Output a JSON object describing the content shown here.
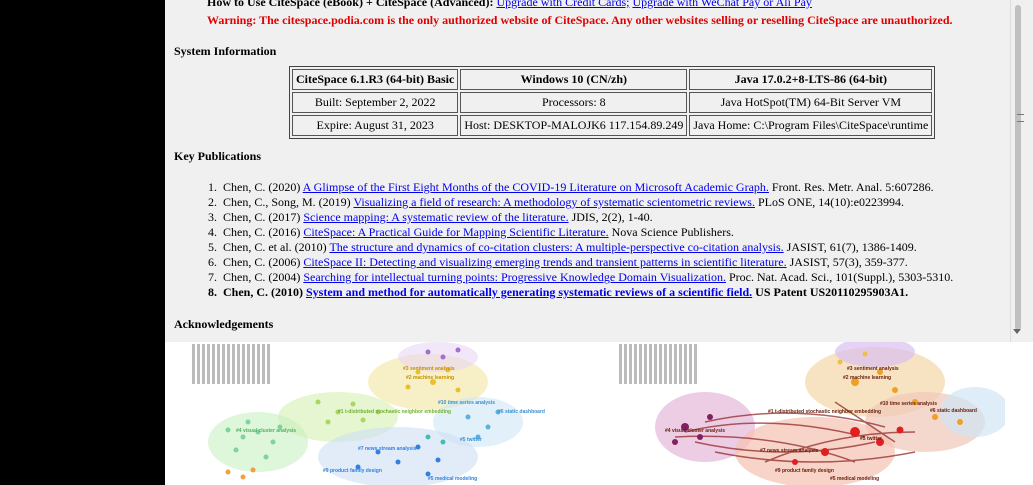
{
  "header": {
    "line1_label": "How to Use CiteSpace (eBook) + CiteSpace (Advanced):",
    "line1_link1": "Upgrade with Credit Cards;",
    "line1_link2": "Upgrade with WeChat Pay or Ali Pay",
    "warning": "Warning: The citespace.podia.com is the only authorized website of CiteSpace. Any other websites selling or reselling CiteSpace are unauthorized."
  },
  "system_info": {
    "heading": "System Information",
    "rows": [
      [
        "CiteSpace 6.1.R3 (64-bit) Basic",
        "Windows 10 (CN/zh)",
        "Java 17.0.2+8-LTS-86 (64-bit)"
      ],
      [
        "Built: September 2, 2022",
        "Processors: 8",
        "Java HotSpot(TM) 64-Bit Server VM"
      ],
      [
        "Expire: August 31, 2023",
        "Host: DESKTOP-MALOJK6 117.154.89.249",
        "Java Home: C:\\Program Files\\CiteSpace\\runtime"
      ]
    ]
  },
  "publications": {
    "heading": "Key Publications",
    "items": [
      {
        "num": "1.",
        "pre": "Chen, C. (2020)",
        "link": "A Glimpse of the First Eight Months of the COVID-19 Literature on Microsoft Academic Graph.",
        "post": "Front. Res. Metr. Anal. 5:607286."
      },
      {
        "num": "2.",
        "pre": "Chen, C., Song, M. (2019)",
        "link": "Visualizing a field of research: A methodology of systematic scientometric reviews.",
        "post": "PLoS ONE, 14(10):e0223994."
      },
      {
        "num": "3.",
        "pre": "Chen, C. (2017)",
        "link": "Science mapping: A systematic review of the literature.",
        "post": "JDIS, 2(2), 1-40."
      },
      {
        "num": "4.",
        "pre": "Chen, C. (2016)",
        "link": "CiteSpace: A Practical Guide for Mapping Scientific Literature.",
        "post": "Nova Science Publishers."
      },
      {
        "num": "5.",
        "pre": "Chen, C. et al. (2010)",
        "link": "The structure and dynamics of co-citation clusters: A multiple-perspective co-citation analysis.",
        "post": "JASIST, 61(7), 1386-1409."
      },
      {
        "num": "6.",
        "pre": "Chen, C. (2006)",
        "link": "CiteSpace II: Detecting and visualizing emerging trends and transient patterns in scientific literature.",
        "post": "JASIST, 57(3), 359-377."
      },
      {
        "num": "7.",
        "pre": "Chen, C. (2004)",
        "link": "Searching for intellectual turning points: Progressive Knowledge Domain Visualization.",
        "post": "Proc. Nat. Acad. Sci., 101(Suppl.), 5303-5310."
      },
      {
        "num": "8.",
        "pre": "Chen, C. (2010)",
        "link": "System and method for automatically generating systematic reviews of a scientific field.",
        "post": "US Patent US20110295903A1."
      }
    ]
  },
  "acknowledgements": {
    "heading": "Acknowledgements"
  },
  "maps": {
    "left": {
      "labels": [
        "#3 sentiment analysis",
        "#2 machine learning",
        "#10 time series analysis",
        "#1 t-distributed stochastic neighbor embedding",
        "#6 static dashboard",
        "#4 visual cluster analysis",
        "#5 twitter",
        "#7 news stream analysis",
        "#9 product family design",
        "#5 medical modeling"
      ]
    },
    "right": {
      "labels": [
        "#3 sentiment analysis",
        "#2 machine learning",
        "#10 time series analysis",
        "#1 t-distributed stochastic neighbor embedding",
        "#6 static dashboard",
        "#4 visual cluster analysis",
        "#5 twitter",
        "#7 news stream analysis",
        "#9 product family design",
        "#5 medical modeling"
      ]
    }
  },
  "colors": {
    "warning": "#e00000",
    "link": "#0000ee"
  }
}
